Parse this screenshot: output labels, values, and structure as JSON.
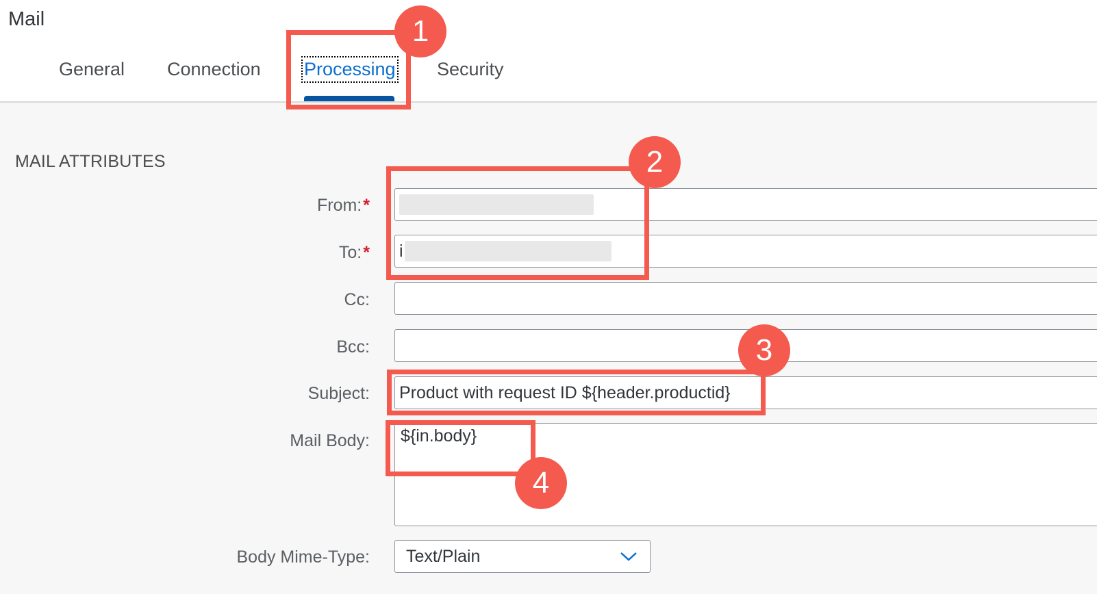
{
  "app": {
    "title": "Mail"
  },
  "tabs": [
    {
      "label": "General"
    },
    {
      "label": "Connection"
    },
    {
      "label": "Processing"
    },
    {
      "label": "Security"
    }
  ],
  "active_tab": "Processing",
  "section": {
    "title": "MAIL ATTRIBUTES"
  },
  "form": {
    "from": {
      "label": "From:",
      "required_mark": "*"
    },
    "to": {
      "label": "To:",
      "required_mark": "*",
      "visible_prefix": "i"
    },
    "cc": {
      "label": "Cc:",
      "value": ""
    },
    "bcc": {
      "label": "Bcc:",
      "value": ""
    },
    "subject": {
      "label": "Subject:",
      "value": "Product with request ID ${header.productid}"
    },
    "mail_body": {
      "label": "Mail Body:",
      "value": "${in.body}"
    },
    "body_mime_type": {
      "label": "Body Mime-Type:",
      "value": "Text/Plain"
    }
  },
  "callouts": [
    {
      "number": "1"
    },
    {
      "number": "2"
    },
    {
      "number": "3"
    },
    {
      "number": "4"
    }
  ],
  "colors": {
    "accent": "#0a6ed1",
    "tab_underline": "#0854a0",
    "callout": "#f55a4e",
    "required": "#d32030"
  }
}
